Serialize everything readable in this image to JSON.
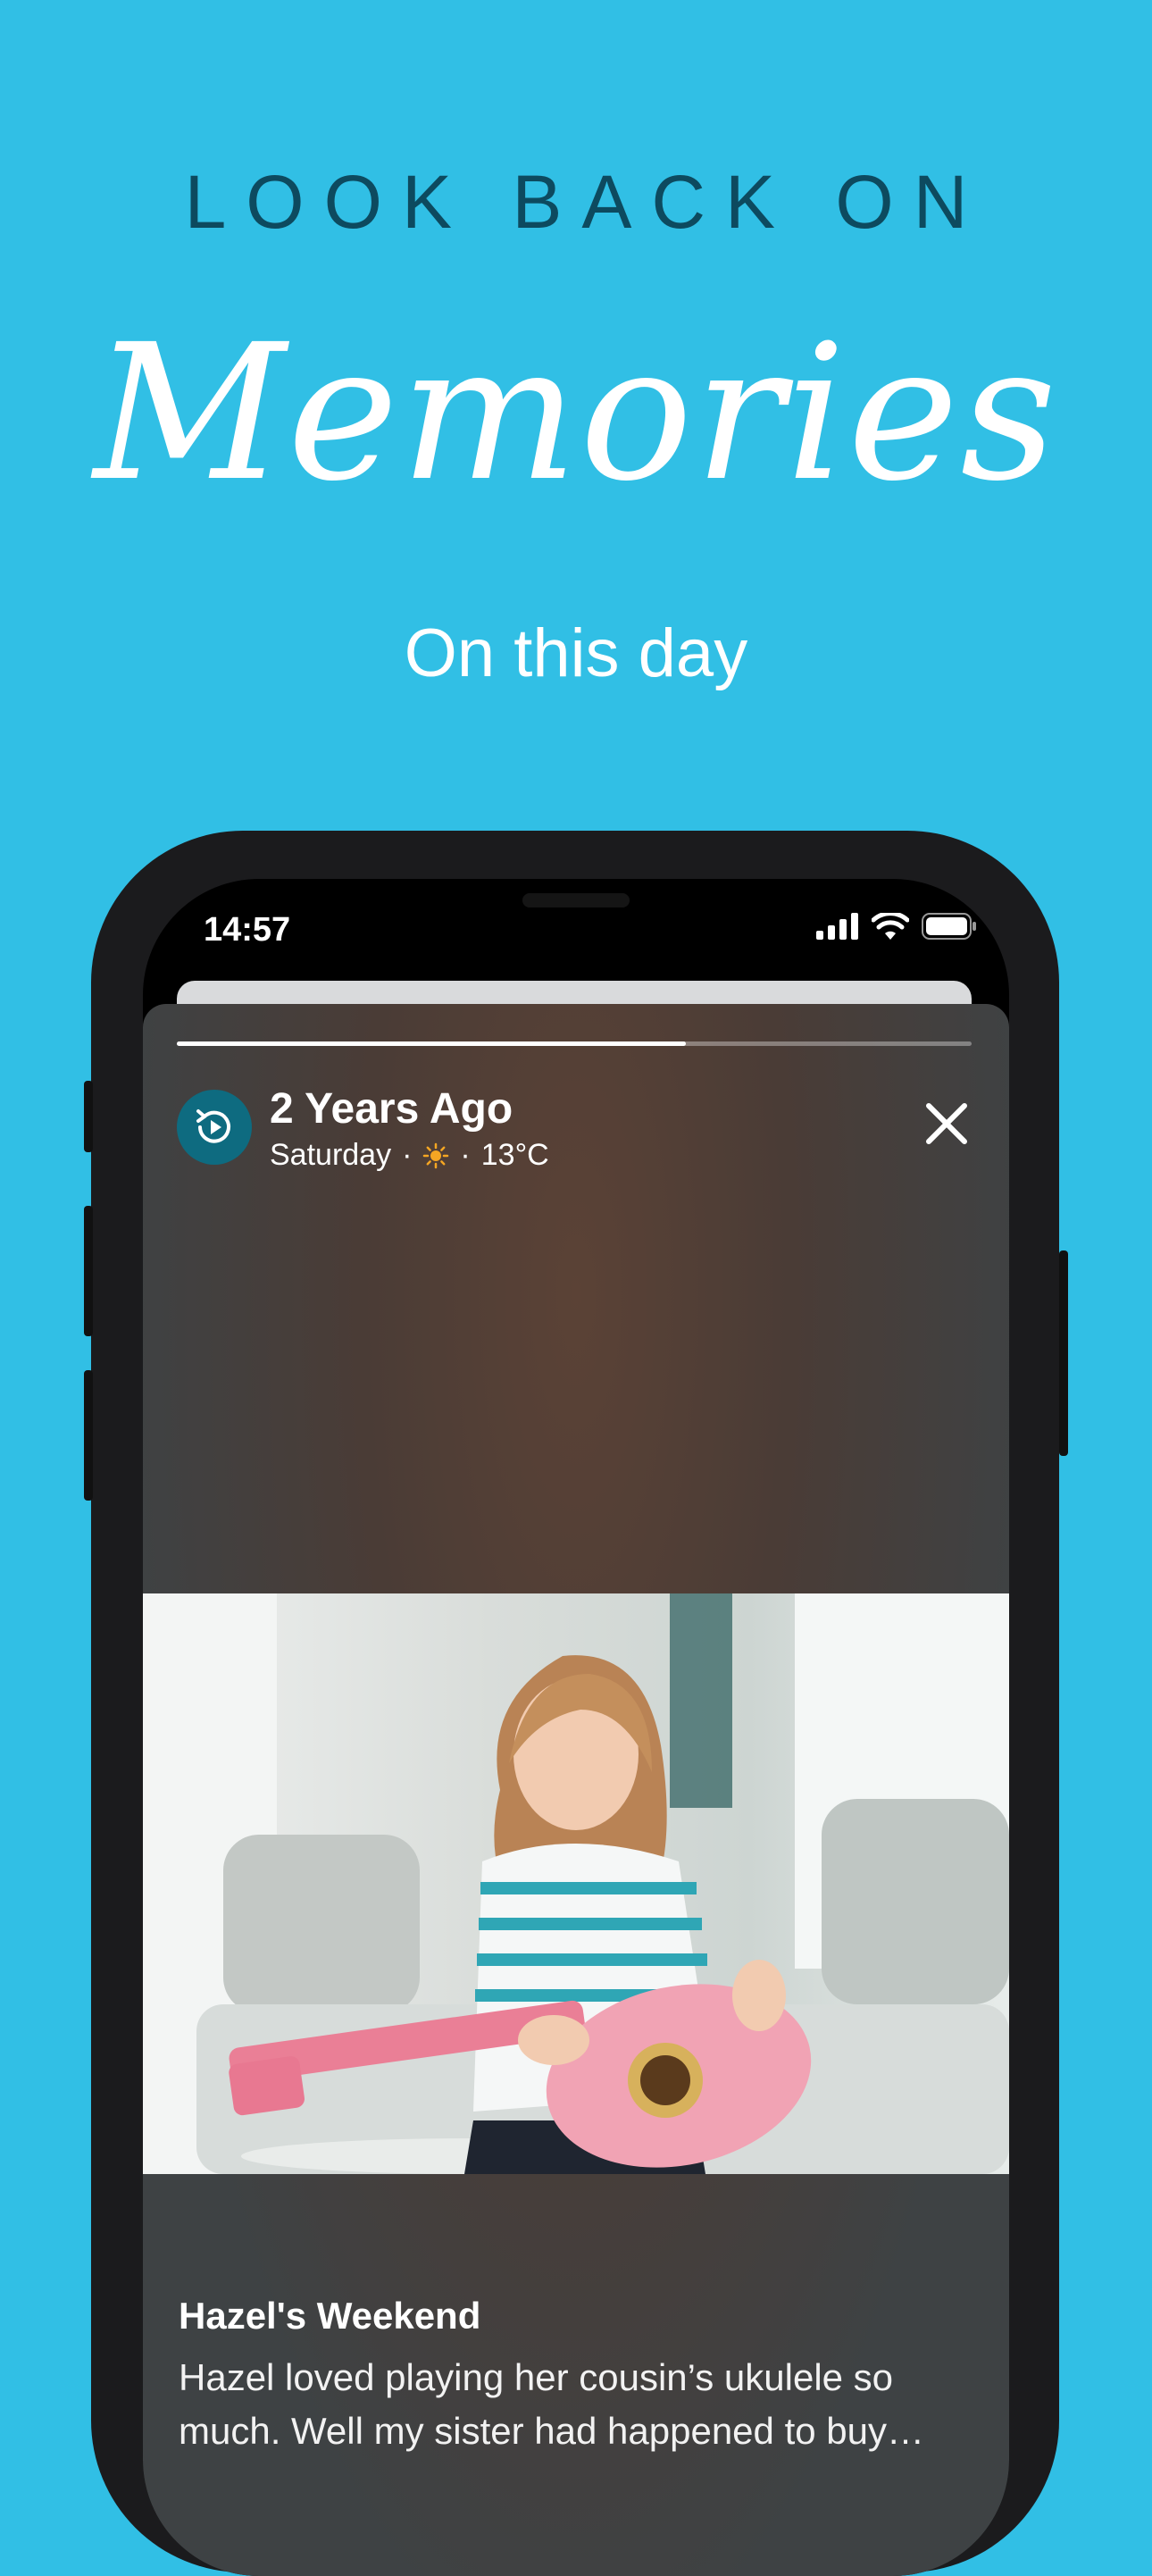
{
  "promo": {
    "headline": "LOOK BACK ON",
    "script_title": "Memories",
    "subtitle": "On this day"
  },
  "status_bar": {
    "time": "14:57",
    "icons": [
      "signal-icon",
      "wifi-icon",
      "battery-icon"
    ]
  },
  "memory": {
    "progress": 0.64,
    "icon": "memory-replay-icon",
    "title": "2 Years Ago",
    "day": "Saturday",
    "separator": "·",
    "weather_icon": "sun-icon",
    "temperature": "13°C",
    "close_icon": "close-icon",
    "caption_title": "Hazel's Weekend",
    "caption_text": "Hazel loved playing her cousin’s ukulele so much. Well my sister had happened to buy…"
  },
  "colors": {
    "background": "#31bfe5",
    "headline": "#0d4a5f",
    "icon_circle": "#0e6b80"
  }
}
